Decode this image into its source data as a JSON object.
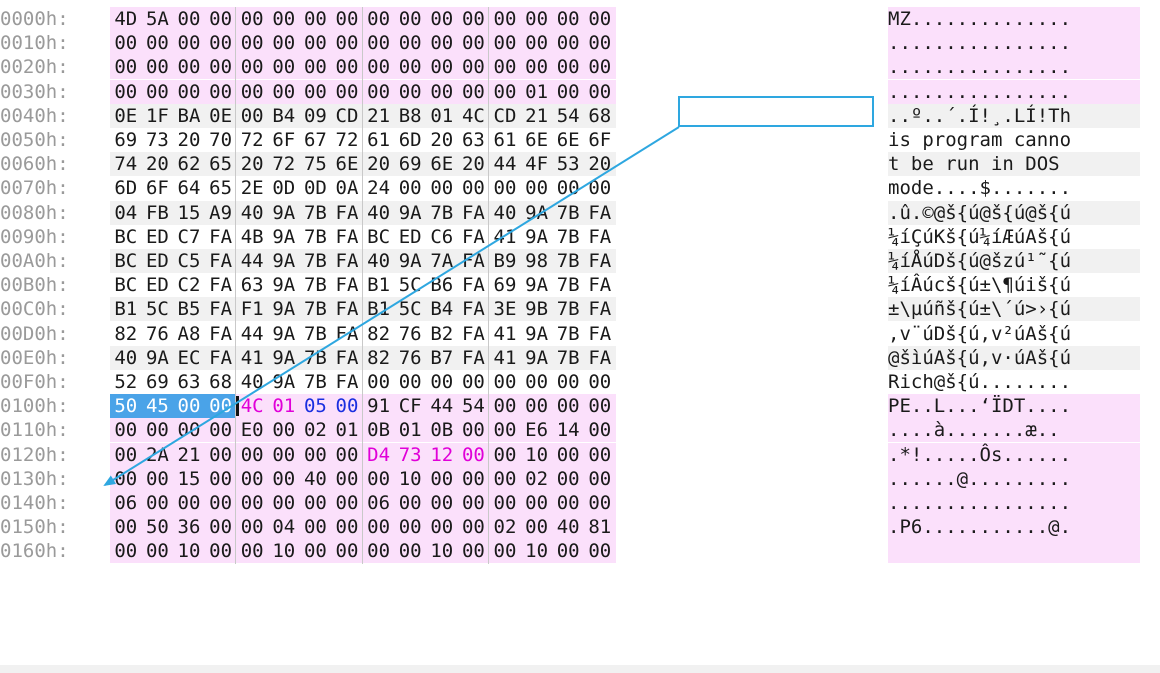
{
  "rows": [
    {
      "offset": "0000h:",
      "bytes": [
        "4D",
        "5A",
        "00",
        "00",
        "00",
        "00",
        "00",
        "00",
        "00",
        "00",
        "00",
        "00",
        "00",
        "00",
        "00",
        "00"
      ],
      "ascii": "MZ.............."
    },
    {
      "offset": "0010h:",
      "bytes": [
        "00",
        "00",
        "00",
        "00",
        "00",
        "00",
        "00",
        "00",
        "00",
        "00",
        "00",
        "00",
        "00",
        "00",
        "00",
        "00"
      ],
      "ascii": "................"
    },
    {
      "offset": "0020h:",
      "bytes": [
        "00",
        "00",
        "00",
        "00",
        "00",
        "00",
        "00",
        "00",
        "00",
        "00",
        "00",
        "00",
        "00",
        "00",
        "00",
        "00"
      ],
      "ascii": "................"
    },
    {
      "offset": "0030h:",
      "bytes": [
        "00",
        "00",
        "00",
        "00",
        "00",
        "00",
        "00",
        "00",
        "00",
        "00",
        "00",
        "00",
        "00",
        "01",
        "00",
        "00"
      ],
      "ascii": "................"
    },
    {
      "offset": "0040h:",
      "bytes": [
        "0E",
        "1F",
        "BA",
        "0E",
        "00",
        "B4",
        "09",
        "CD",
        "21",
        "B8",
        "01",
        "4C",
        "CD",
        "21",
        "54",
        "68"
      ],
      "ascii": "..º..´.Í!¸.LÍ!Th"
    },
    {
      "offset": "0050h:",
      "bytes": [
        "69",
        "73",
        "20",
        "70",
        "72",
        "6F",
        "67",
        "72",
        "61",
        "6D",
        "20",
        "63",
        "61",
        "6E",
        "6E",
        "6F"
      ],
      "ascii": "is program canno"
    },
    {
      "offset": "0060h:",
      "bytes": [
        "74",
        "20",
        "62",
        "65",
        "20",
        "72",
        "75",
        "6E",
        "20",
        "69",
        "6E",
        "20",
        "44",
        "4F",
        "53",
        "20"
      ],
      "ascii": "t be run in DOS "
    },
    {
      "offset": "0070h:",
      "bytes": [
        "6D",
        "6F",
        "64",
        "65",
        "2E",
        "0D",
        "0D",
        "0A",
        "24",
        "00",
        "00",
        "00",
        "00",
        "00",
        "00",
        "00"
      ],
      "ascii": "mode....$......."
    },
    {
      "offset": "0080h:",
      "bytes": [
        "04",
        "FB",
        "15",
        "A9",
        "40",
        "9A",
        "7B",
        "FA",
        "40",
        "9A",
        "7B",
        "FA",
        "40",
        "9A",
        "7B",
        "FA"
      ],
      "ascii": ".û.©@š{ú@š{ú@š{ú"
    },
    {
      "offset": "0090h:",
      "bytes": [
        "BC",
        "ED",
        "C7",
        "FA",
        "4B",
        "9A",
        "7B",
        "FA",
        "BC",
        "ED",
        "C6",
        "FA",
        "41",
        "9A",
        "7B",
        "FA"
      ],
      "ascii": "¼íÇúKš{ú¼íÆúAš{ú"
    },
    {
      "offset": "00A0h:",
      "bytes": [
        "BC",
        "ED",
        "C5",
        "FA",
        "44",
        "9A",
        "7B",
        "FA",
        "40",
        "9A",
        "7A",
        "FA",
        "B9",
        "98",
        "7B",
        "FA"
      ],
      "ascii": "¼íÅúDš{ú@šzú¹˜{ú"
    },
    {
      "offset": "00B0h:",
      "bytes": [
        "BC",
        "ED",
        "C2",
        "FA",
        "63",
        "9A",
        "7B",
        "FA",
        "B1",
        "5C",
        "B6",
        "FA",
        "69",
        "9A",
        "7B",
        "FA"
      ],
      "ascii": "¼íÂúcš{ú±\\¶úiš{ú"
    },
    {
      "offset": "00C0h:",
      "bytes": [
        "B1",
        "5C",
        "B5",
        "FA",
        "F1",
        "9A",
        "7B",
        "FA",
        "B1",
        "5C",
        "B4",
        "FA",
        "3E",
        "9B",
        "7B",
        "FA"
      ],
      "ascii": "±\\µúñš{ú±\\´ú>›{ú"
    },
    {
      "offset": "00D0h:",
      "bytes": [
        "82",
        "76",
        "A8",
        "FA",
        "44",
        "9A",
        "7B",
        "FA",
        "82",
        "76",
        "B2",
        "FA",
        "41",
        "9A",
        "7B",
        "FA"
      ],
      "ascii": "‚v¨úDš{ú‚v²úAš{ú"
    },
    {
      "offset": "00E0h:",
      "bytes": [
        "40",
        "9A",
        "EC",
        "FA",
        "41",
        "9A",
        "7B",
        "FA",
        "82",
        "76",
        "B7",
        "FA",
        "41",
        "9A",
        "7B",
        "FA"
      ],
      "ascii": "@šìúAš{ú‚v·úAš{ú"
    },
    {
      "offset": "00F0h:",
      "bytes": [
        "52",
        "69",
        "63",
        "68",
        "40",
        "9A",
        "7B",
        "FA",
        "00",
        "00",
        "00",
        "00",
        "00",
        "00",
        "00",
        "00"
      ],
      "ascii": "Rich@š{ú........"
    },
    {
      "offset": "0100h:",
      "bytes": [
        "50",
        "45",
        "00",
        "00",
        "4C",
        "01",
        "05",
        "00",
        "91",
        "CF",
        "44",
        "54",
        "00",
        "00",
        "00",
        "00"
      ],
      "ascii": "PE..L...‘ÏDT...."
    },
    {
      "offset": "0110h:",
      "bytes": [
        "00",
        "00",
        "00",
        "00",
        "E0",
        "00",
        "02",
        "01",
        "0B",
        "01",
        "0B",
        "00",
        "00",
        "E6",
        "14",
        "00"
      ],
      "ascii": "....à.......æ.."
    },
    {
      "offset": "0120h:",
      "bytes": [
        "00",
        "2A",
        "21",
        "00",
        "00",
        "00",
        "00",
        "00",
        "D4",
        "73",
        "12",
        "00",
        "00",
        "10",
        "00",
        "00"
      ],
      "ascii": ".*!.....Ôs......"
    },
    {
      "offset": "0130h:",
      "bytes": [
        "00",
        "00",
        "15",
        "00",
        "00",
        "00",
        "40",
        "00",
        "00",
        "10",
        "00",
        "00",
        "00",
        "02",
        "00",
        "00"
      ],
      "ascii": "......@........."
    },
    {
      "offset": "0140h:",
      "bytes": [
        "06",
        "00",
        "00",
        "00",
        "00",
        "00",
        "00",
        "00",
        "06",
        "00",
        "00",
        "00",
        "00",
        "00",
        "00",
        "00"
      ],
      "ascii": "................"
    },
    {
      "offset": "0150h:",
      "bytes": [
        "00",
        "50",
        "36",
        "00",
        "00",
        "04",
        "00",
        "00",
        "00",
        "00",
        "00",
        "00",
        "02",
        "00",
        "40",
        "81"
      ],
      "ascii": ".P6...........@."
    },
    {
      "offset": "0160h:",
      "bytes": [
        "00",
        "00",
        "10",
        "00",
        "00",
        "10",
        "00",
        "00",
        "00",
        "00",
        "10",
        "00",
        "00",
        "10",
        "00",
        "00"
      ],
      "ascii": ""
    }
  ],
  "colors": {
    "pink": "#fbe0fb",
    "selection": "#4aa3e8",
    "magenta": "#e000d8",
    "blue": "#1a2fe0",
    "arrow": "#2ea7e0",
    "address": "#9a9a9a"
  }
}
